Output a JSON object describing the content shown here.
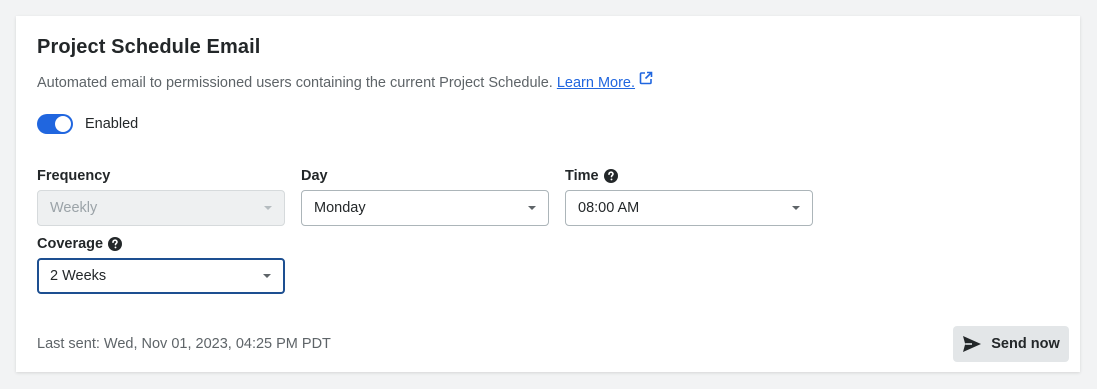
{
  "card": {
    "title": "Project Schedule Email",
    "description": "Automated email to permissioned users containing the current Project Schedule.",
    "learn_more_label": "Learn More."
  },
  "toggle": {
    "label": "Enabled",
    "state": "on"
  },
  "fields": {
    "frequency": {
      "label": "Frequency",
      "value": "Weekly",
      "disabled": true
    },
    "day": {
      "label": "Day",
      "value": "Monday"
    },
    "time": {
      "label": "Time",
      "value": "08:00 AM"
    },
    "coverage": {
      "label": "Coverage",
      "value": "2 Weeks",
      "focused": true
    }
  },
  "footer": {
    "last_sent": "Last sent: Wed, Nov 01, 2023, 04:25 PM PDT",
    "send_now_label": "Send now"
  },
  "colors": {
    "accent": "#2066df",
    "focus_border": "#1d4f91",
    "button_bg": "#e3e6e8"
  },
  "icons": {
    "external_link": "external-link-icon",
    "help": "help-circle-icon",
    "dropdown": "caret-down-icon",
    "send": "paper-plane-icon"
  }
}
